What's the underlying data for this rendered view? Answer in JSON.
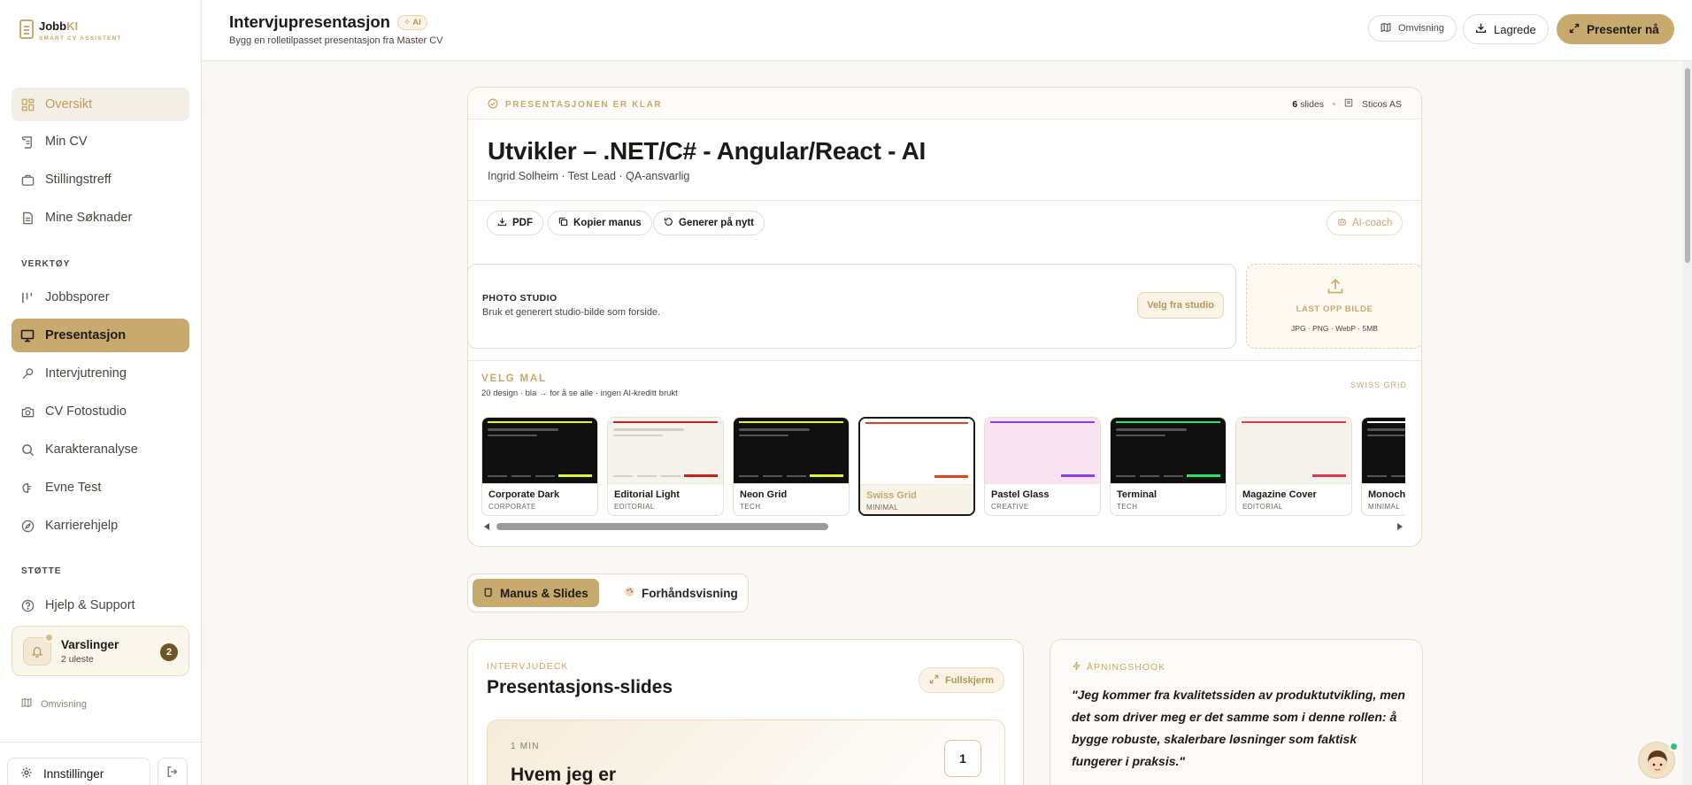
{
  "brand": {
    "name_a": "Jobb",
    "name_b": "KI",
    "tagline": "SMART CV ASSISTENT"
  },
  "sidebar": {
    "items": [
      {
        "label": "Oversikt",
        "icon": "grid-icon"
      },
      {
        "label": "Min CV",
        "icon": "scroll-icon"
      },
      {
        "label": "Stillingstreff",
        "icon": "briefcase-icon"
      },
      {
        "label": "Mine Søknader",
        "icon": "document-icon"
      }
    ],
    "tools_label": "VERKTØY",
    "tools": [
      {
        "label": "Jobbsporer",
        "icon": "kanban-icon"
      },
      {
        "label": "Presentasjon",
        "icon": "monitor-icon"
      },
      {
        "label": "Intervjutrening",
        "icon": "microphone-icon"
      },
      {
        "label": "CV Fotostudio",
        "icon": "camera-icon"
      },
      {
        "label": "Karakteranalyse",
        "icon": "search-icon"
      },
      {
        "label": "Evne Test",
        "icon": "brain-icon"
      },
      {
        "label": "Karrierehjelp",
        "icon": "compass-icon"
      }
    ],
    "support_label": "STØTTE",
    "support": [
      {
        "label": "Hjelp & Support",
        "icon": "help-icon"
      }
    ],
    "notifications": {
      "title": "Varslinger",
      "subtitle": "2 uleste",
      "count": "2"
    },
    "tour_label": "Omvisning",
    "settings_label": "Innstillinger"
  },
  "header": {
    "title": "Intervjupresentasjon",
    "ai_badge": "AI",
    "subtitle": "Bygg en rolletilpasset presentasjon fra Master CV",
    "tour_label": "Omvisning",
    "saved_label": "Lagrede",
    "present_label": "Presenter nå"
  },
  "deck": {
    "status": "PRESENTASJONEN ER KLAR",
    "slides_count": "6",
    "slides_word": "slides",
    "company": "Sticos AS",
    "title": "Utvikler – .NET/C# - Angular/React - AI",
    "subtitle": "Ingrid Solheim · Test Lead · QA-ansvarlig",
    "actions": {
      "pdf": "PDF",
      "copy": "Kopier manus",
      "regen": "Generer på nytt",
      "coach": "AI-coach"
    }
  },
  "photo_studio": {
    "title": "PHOTO STUDIO",
    "subtitle": "Bruk et generert studio-bilde som forside.",
    "button": "Velg fra studio",
    "upload_title": "LAST OPP BILDE",
    "upload_sub": "JPG · PNG · WebP · 5MB"
  },
  "templates": {
    "title": "VELG MAL",
    "subtitle": "20 design · bla → for å se alle · ingen AI-kreditt brukt",
    "selected_label": "SWISS GRID",
    "items": [
      {
        "name": "Corporate Dark",
        "category": "CORPORATE",
        "bg": "#0f0f0f",
        "accent": "#e2f52b",
        "lines": "#555555"
      },
      {
        "name": "Editorial Light",
        "category": "EDITORIAL",
        "bg": "#f6f2ec",
        "accent": "#c81e1e",
        "lines": "#d6cfc4"
      },
      {
        "name": "Neon Grid",
        "category": "TECH",
        "bg": "#0f0f0f",
        "accent": "#e2f52b",
        "lines": "#555555"
      },
      {
        "name": "Swiss Grid",
        "category": "MINIMAL",
        "bg": "#ffffff",
        "accent": "#e8401c",
        "lines": "#ffffff"
      },
      {
        "name": "Pastel Glass",
        "category": "CREATIVE",
        "bg": "#f8e4f0",
        "accent": "#8a3ee0",
        "lines": "#f8e4f0"
      },
      {
        "name": "Terminal",
        "category": "TECH",
        "bg": "#0f0f0f",
        "accent": "#2be36a",
        "lines": "#555555"
      },
      {
        "name": "Magazine Cover",
        "category": "EDITORIAL",
        "bg": "#f6f2ec",
        "accent": "#e8334a",
        "lines": "#f6f2ec"
      },
      {
        "name": "Monochrome",
        "category": "MINIMAL",
        "bg": "#0f0f0f",
        "accent": "#ffffff",
        "lines": "#555555"
      }
    ]
  },
  "tabs": {
    "script": "Manus & Slides",
    "preview": "Forhåndsvisning"
  },
  "slides_panel": {
    "kicker": "INTERVJUDECK",
    "title": "Presentasjons-slides",
    "fullscreen": "Fullskjerm",
    "first_slide": {
      "duration": "1 MIN",
      "title": "Hvem jeg er",
      "number": "1"
    }
  },
  "hook": {
    "kicker": "ÅPNINGSHOOK",
    "text": "\"Jeg kommer fra kvalitetssiden av produktutvikling, men det som driver meg er det samme som i denne rollen: å bygge robuste, skalerbare løsninger som faktisk fungerer i praksis.\""
  },
  "colors": {
    "accent": "#c9aa6e",
    "accent_text": "#c9a86a"
  }
}
